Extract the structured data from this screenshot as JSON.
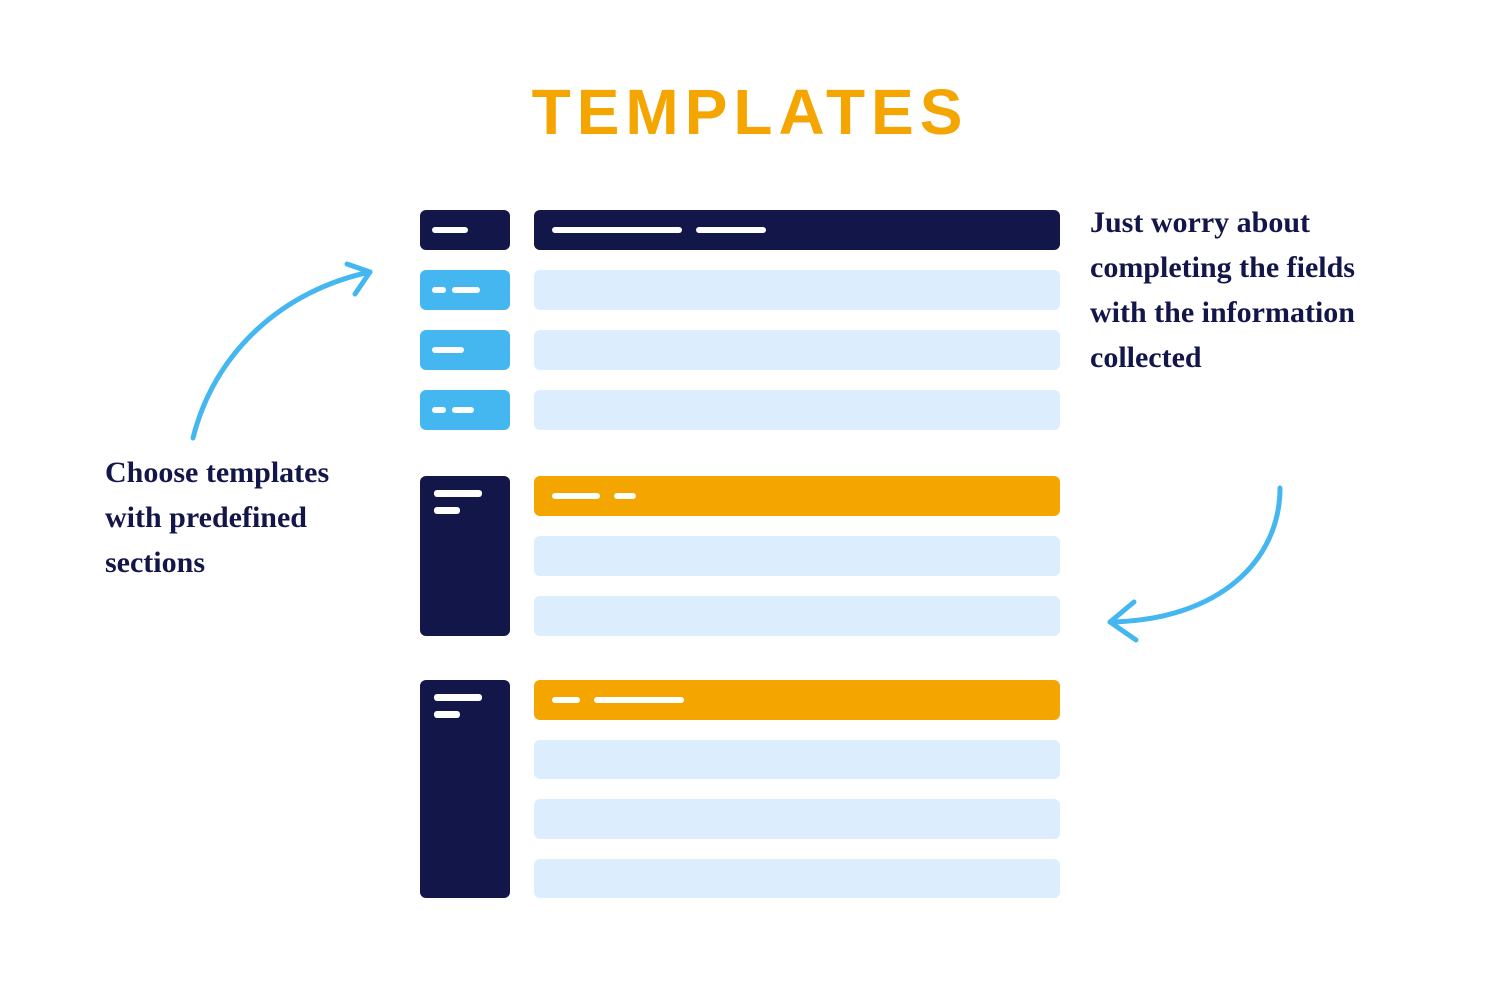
{
  "title": "TEMPLATES",
  "captions": {
    "left": "Choose templates with predefined sections",
    "right": "Just worry about completing the fields with the information collected"
  },
  "colors": {
    "navy": "#131649",
    "blue": "#45B7F0",
    "pale": "#DCEEFE",
    "gold": "#F5A500"
  }
}
